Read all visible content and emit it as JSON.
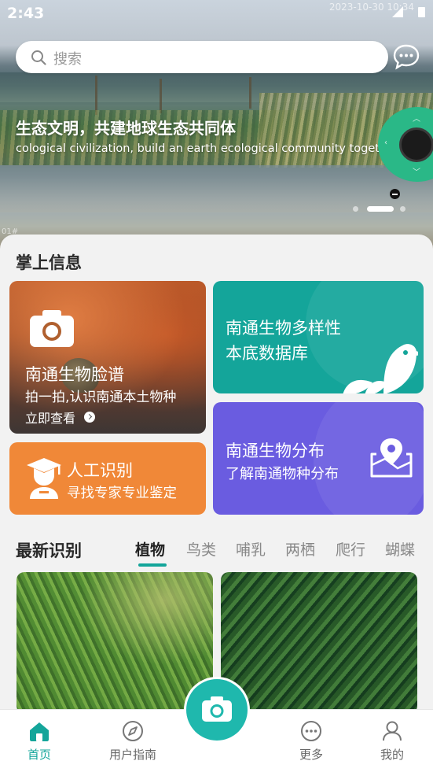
{
  "status_bar": {
    "time": "2:43",
    "watermark_date": "2023-10-30 10:34"
  },
  "search": {
    "placeholder": "搜索"
  },
  "banner": {
    "title": "生态文明，共建地球生态共同体",
    "subtitle": "cological civilization, build an earth ecological community together",
    "image_mark": "01#",
    "slide_count": 3,
    "active_slide": 2
  },
  "section_info": {
    "title": "掌上信息"
  },
  "cards": {
    "face": {
      "title": "南通生物脸谱",
      "desc": "拍一拍,认识南通本土物种",
      "action": "立即查看"
    },
    "database": {
      "line1": "南通生物多样性",
      "line2": "本底数据库"
    },
    "expert": {
      "title": "人工识别",
      "desc": "寻找专家专业鉴定"
    },
    "distribution": {
      "title": "南通生物分布",
      "desc": "了解南通物种分布"
    }
  },
  "latest": {
    "title": "最新识别",
    "tabs": [
      "植物",
      "鸟类",
      "哺乳",
      "两栖",
      "爬行",
      "蝴蝶"
    ],
    "active_tab": 0
  },
  "bottom_nav": {
    "items": [
      {
        "label": "首页",
        "icon": "home-icon"
      },
      {
        "label": "用户指南",
        "icon": "compass-icon"
      },
      {
        "label": "更多",
        "icon": "more-icon"
      },
      {
        "label": "我的",
        "icon": "profile-icon"
      }
    ],
    "active": 0
  },
  "colors": {
    "accent": "#14a59a",
    "database_card": "#14a59a",
    "expert_card": "#f08838",
    "distribution_card": "#6a5ce0"
  }
}
